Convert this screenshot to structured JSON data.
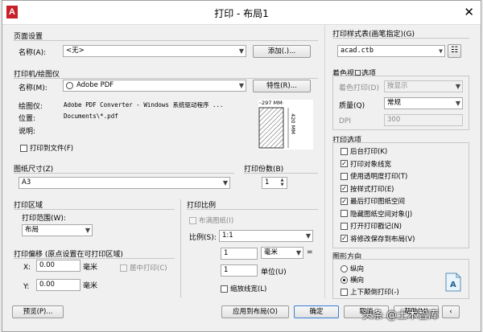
{
  "window": {
    "title": "打印 - 布局1",
    "app_icon_letter": "A",
    "close_glyph": "✕"
  },
  "page_setup": {
    "group_label": "页面设置",
    "name_label": "名称(A):",
    "name_value": "<无>",
    "add_button": "添加(.)..."
  },
  "printer": {
    "group_label": "打印机/绘图仪",
    "name_label": "名称(M):",
    "name_value": "Adobe PDF",
    "properties_button": "特性(R)...",
    "plotter_label": "绘图仪:",
    "plotter_value": "Adobe PDF Converter - Windows 系统驱动程序 ...",
    "location_label": "位置:",
    "location_value": "Documents\\*.pdf",
    "description_label": "说明:",
    "print_to_file_label": "打印到文件(F)",
    "print_to_file_checked": false,
    "preview_width": "297 MM",
    "preview_height": "420 MM"
  },
  "paper_size": {
    "group_label": "图纸尺寸(Z)",
    "value": "A3"
  },
  "copies": {
    "group_label": "打印份数(B)",
    "value": "1"
  },
  "plot_area": {
    "group_label": "打印区域",
    "range_label": "打印范围(W):",
    "range_value": "布局"
  },
  "plot_offset": {
    "group_label": "打印偏移 (原点设置在可打印区域)",
    "x_label": "X:",
    "x_value": "0.00",
    "x_unit": "毫米",
    "y_label": "Y:",
    "y_value": "0.00",
    "y_unit": "毫米",
    "center_label": "居中打印(C)",
    "center_checked": false
  },
  "plot_scale": {
    "group_label": "打印比例",
    "fit_paper_label": "布满图纸(I)",
    "fit_paper_checked": false,
    "scale_label": "比例(S):",
    "scale_value": "1:1",
    "value1": "1",
    "unit1": "毫米",
    "equals": "=",
    "value2": "1",
    "unit2": "单位(U)",
    "scale_lineweights_label": "缩放线宽(L)",
    "scale_lineweights_checked": false
  },
  "plot_style_table": {
    "group_label": "打印样式表(画笔指定)(G)",
    "value": "acad.ctb"
  },
  "shaded_viewport": {
    "group_label": "着色视口选项",
    "shade_label": "着色打印(D)",
    "shade_value": "按显示",
    "quality_label": "质量(Q)",
    "quality_value": "常规",
    "dpi_label": "DPI",
    "dpi_value": "300"
  },
  "plot_options": {
    "group_label": "打印选项",
    "items": [
      {
        "label": "后台打印(K)",
        "checked": false
      },
      {
        "label": "打印对象线宽",
        "checked": true
      },
      {
        "label": "使用透明度打印(T)",
        "checked": false
      },
      {
        "label": "按样式打印(E)",
        "checked": true
      },
      {
        "label": "最后打印图纸空间",
        "checked": true
      },
      {
        "label": "隐藏图纸空间对象(J)",
        "checked": false
      },
      {
        "label": "打开打印戳记(N)",
        "checked": false
      },
      {
        "label": "将修改保存到布局(V)",
        "checked": true
      }
    ]
  },
  "drawing_orientation": {
    "group_label": "图形方向",
    "portrait_label": "纵向",
    "landscape_label": "横向",
    "selected": "landscape",
    "upside_down_label": "上下颠倒打印(-)",
    "upside_down_checked": false
  },
  "footer": {
    "preview_button": "预览(P)...",
    "apply_button": "应用到布局(O)",
    "ok_button": "确定",
    "cancel_button": "取消",
    "help_button": "帮助(H)"
  },
  "watermark": "头条 @土木智库"
}
